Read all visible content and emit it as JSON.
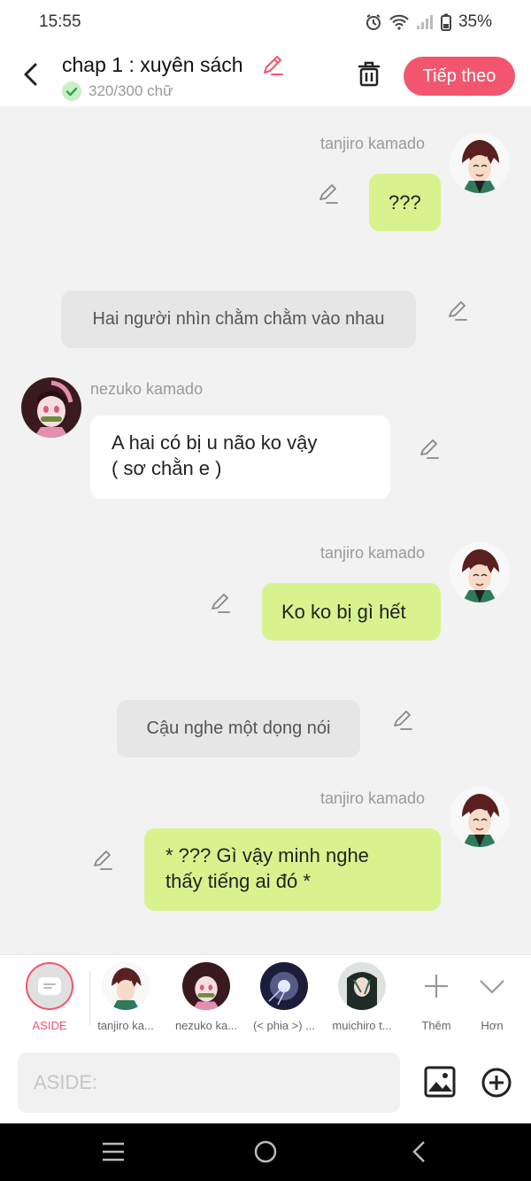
{
  "status": {
    "time": "15:55",
    "battery": "35%",
    "icons": [
      "alarm-icon",
      "wifi-icon",
      "signal-icon",
      "battery-icon"
    ]
  },
  "header": {
    "title": "chap 1 : xuyên sách",
    "word_count": "320/300 chữ",
    "next_label": "Tiếp theo",
    "accent_color": "#f2566e"
  },
  "messages": [
    {
      "type": "right",
      "sender": "tanjiro kamado",
      "text": "???"
    },
    {
      "type": "aside",
      "text": "Hai người nhìn chằm chằm vào nhau"
    },
    {
      "type": "left",
      "sender": "nezuko kamado",
      "text_line1": "A hai có bị u não ko vậy",
      "text_line2": "( sơ chằn e )"
    },
    {
      "type": "right",
      "sender": "tanjiro kamado",
      "text": "Ko ko bị gì hết"
    },
    {
      "type": "aside",
      "text": "Cậu nghe một dọng nói"
    },
    {
      "type": "right",
      "sender": "tanjiro kamado",
      "text_line1": "* ??? Gì vậy minh nghe",
      "text_line2": "thấy tiếng ai đó *"
    }
  ],
  "characters": {
    "aside_label": "ASIDE",
    "items": [
      {
        "label": "tanjiro ka..."
      },
      {
        "label": "nezuko ka..."
      },
      {
        "label": "(< phia >) ..."
      },
      {
        "label": "muichiro t..."
      }
    ],
    "more_label": "Thêm",
    "expand_label": "Hơn"
  },
  "input": {
    "placeholder": "ASIDE:"
  },
  "colors": {
    "green_bubble": "#d8f38e",
    "aside_bubble": "#e6e6e6",
    "background": "#f2f2f2"
  }
}
